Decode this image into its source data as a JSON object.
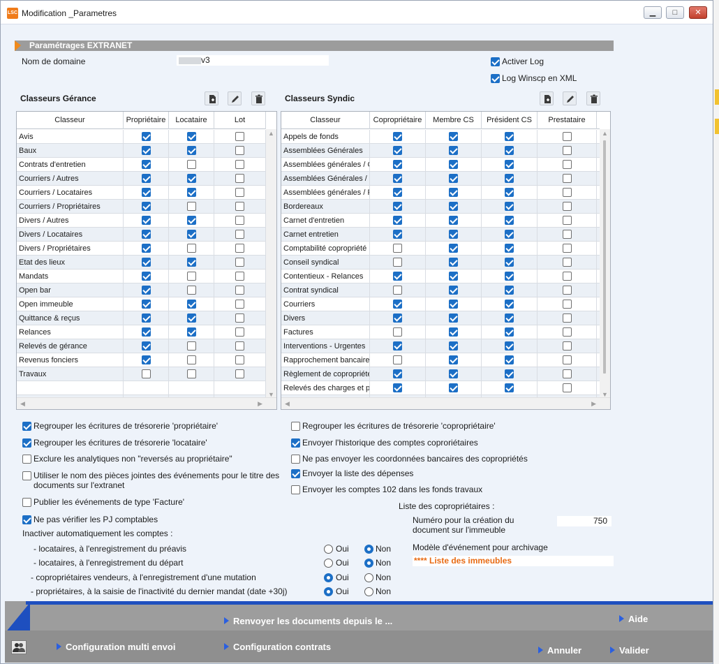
{
  "window": {
    "title": "Modification _Parametres",
    "app_icon_text": "LSC",
    "minimize_glyph": "▁",
    "maximize_glyph": "□",
    "close_glyph": "✕"
  },
  "extranet": {
    "section_title": "Paramétrages EXTRANET",
    "domain_label": "Nom de domaine",
    "domain_value": "v3",
    "activer_log": {
      "label": "Activer Log",
      "checked": true
    },
    "log_winscp": {
      "label": "Log Winscp en XML",
      "checked": true
    }
  },
  "gerance": {
    "title": "Classeurs Gérance",
    "columns": [
      "Classeur",
      "Propriétaire",
      "Locataire",
      "Lot"
    ],
    "rows": [
      {
        "name": "Avis",
        "checks": [
          true,
          true,
          false
        ]
      },
      {
        "name": "Baux",
        "checks": [
          true,
          true,
          false
        ]
      },
      {
        "name": "Contrats d'entretien",
        "checks": [
          true,
          false,
          false
        ]
      },
      {
        "name": "Courriers / Autres",
        "checks": [
          true,
          true,
          false
        ]
      },
      {
        "name": "Courriers / Locataires",
        "checks": [
          true,
          true,
          false
        ]
      },
      {
        "name": "Courriers / Propriétaires",
        "checks": [
          true,
          false,
          false
        ]
      },
      {
        "name": "Divers / Autres",
        "checks": [
          true,
          true,
          false
        ]
      },
      {
        "name": "Divers / Locataires",
        "checks": [
          true,
          true,
          false
        ]
      },
      {
        "name": "Divers / Propriétaires",
        "checks": [
          true,
          false,
          false
        ]
      },
      {
        "name": "Etat des lieux",
        "checks": [
          true,
          true,
          false
        ]
      },
      {
        "name": "Mandats",
        "checks": [
          true,
          false,
          false
        ]
      },
      {
        "name": "Open bar",
        "checks": [
          true,
          false,
          false
        ]
      },
      {
        "name": "Open immeuble",
        "checks": [
          true,
          true,
          false
        ]
      },
      {
        "name": "Quittance & reçus",
        "checks": [
          true,
          true,
          false
        ]
      },
      {
        "name": "Relances",
        "checks": [
          true,
          true,
          false
        ]
      },
      {
        "name": "Relevés de gérance",
        "checks": [
          true,
          false,
          false
        ]
      },
      {
        "name": "Revenus fonciers",
        "checks": [
          true,
          false,
          false
        ]
      },
      {
        "name": "Travaux",
        "checks": [
          false,
          false,
          false
        ]
      }
    ]
  },
  "syndic": {
    "title": "Classeurs Syndic",
    "columns": [
      "Classeur",
      "Copropriétaire",
      "Membre CS",
      "Président CS",
      "Prestataire"
    ],
    "rows": [
      {
        "name": "Appels de fonds",
        "checks": [
          true,
          true,
          true,
          false
        ]
      },
      {
        "name": "Assemblées Générales",
        "checks": [
          true,
          true,
          true,
          false
        ]
      },
      {
        "name": "Assemblées générales / C",
        "checks": [
          true,
          true,
          true,
          false
        ]
      },
      {
        "name": "Assemblées Générales / D",
        "checks": [
          true,
          true,
          true,
          false
        ]
      },
      {
        "name": "Assemblées générales / P",
        "checks": [
          true,
          true,
          true,
          false
        ]
      },
      {
        "name": "Bordereaux",
        "checks": [
          true,
          true,
          true,
          false
        ]
      },
      {
        "name": "Carnet d'entretien",
        "checks": [
          true,
          true,
          true,
          false
        ]
      },
      {
        "name": "Carnet entretien",
        "checks": [
          true,
          true,
          true,
          false
        ]
      },
      {
        "name": "Comptabilité copropriété",
        "checks": [
          false,
          true,
          true,
          false
        ]
      },
      {
        "name": "Conseil syndical",
        "checks": [
          false,
          true,
          true,
          false
        ]
      },
      {
        "name": "Contentieux - Relances",
        "checks": [
          true,
          true,
          true,
          false
        ]
      },
      {
        "name": "Contrat syndical",
        "checks": [
          false,
          true,
          true,
          false
        ]
      },
      {
        "name": "Courriers",
        "checks": [
          true,
          true,
          true,
          false
        ]
      },
      {
        "name": "Divers",
        "checks": [
          true,
          true,
          true,
          false
        ]
      },
      {
        "name": "Factures",
        "checks": [
          false,
          true,
          true,
          false
        ]
      },
      {
        "name": "Interventions - Urgentes",
        "checks": [
          true,
          true,
          true,
          false
        ]
      },
      {
        "name": "Rapprochement bancaire",
        "checks": [
          false,
          true,
          true,
          false
        ]
      },
      {
        "name": "Règlement de copropriété",
        "checks": [
          true,
          true,
          true,
          false
        ]
      },
      {
        "name": "Relevés des charges et pr",
        "checks": [
          true,
          true,
          true,
          false
        ]
      }
    ]
  },
  "options_left": [
    {
      "label": "Regrouper les écritures de trésorerie 'propriétaire'",
      "checked": true
    },
    {
      "label": "Regrouper les écritures de trésorerie 'locataire'",
      "checked": true
    },
    {
      "label": "Exclure les analytiques non \"reversés au propriétaire\"",
      "checked": false
    },
    {
      "label": "Utiliser le nom des pièces jointes des événements pour le titre des",
      "label2": "documents sur l'extranet",
      "checked": false
    },
    {
      "label": "Publier les événements de type 'Facture'",
      "checked": false
    },
    {
      "label": "Ne pas vérifier les PJ comptables",
      "checked": true
    }
  ],
  "options_right": [
    {
      "label": "Regrouper les écritures de trésorerie 'copropriétaire'",
      "checked": false
    },
    {
      "label": "Envoyer l'historique des comptes coproriétaires",
      "checked": true
    },
    {
      "label": "Ne pas envoyer les coordonnées bancaires des copropriétés",
      "checked": false
    },
    {
      "label": "Envoyer la liste des dépenses",
      "checked": true
    },
    {
      "label": "Envoyer les comptes 102 dans les fonds travaux",
      "checked": false
    }
  ],
  "inactivation": {
    "title": "Inactiver automatiquement les comptes :",
    "oui": "Oui",
    "non": "Non",
    "rows": [
      {
        "label": "- locataires, à l'enregistrement du préavis",
        "value": "Non"
      },
      {
        "label": "- locataires, à l'enregistrement du départ",
        "value": "Non"
      },
      {
        "label": "- copropriétaires vendeurs, à l'enregistrement d'une mutation",
        "value": "Oui"
      },
      {
        "label": "- propriétaires, à la saisie de l'inactivité du dernier mandat (date +30j)",
        "value": "Oui"
      }
    ]
  },
  "coproprietaires": {
    "title": "Liste des copropriétaires :",
    "numero_label_1": "Numéro pour la création du",
    "numero_label_2": "document sur l'immeuble",
    "numero_value": "750",
    "modele_label": "Modèle d'événement pour archivage",
    "modele_value": "**** Liste des immeubles"
  },
  "actions": {
    "renvoyer": "Renvoyer les documents depuis le ...",
    "aide": "Aide",
    "config_multi": "Configuration multi envoi",
    "config_contrats": "Configuration contrats",
    "annuler": "Annuler",
    "valider": "Valider"
  },
  "colors": {
    "accent": "#1e4fbf",
    "check": "#1c6fc6",
    "orange": "#e86b14",
    "header_grey": "#9c9c9c"
  }
}
